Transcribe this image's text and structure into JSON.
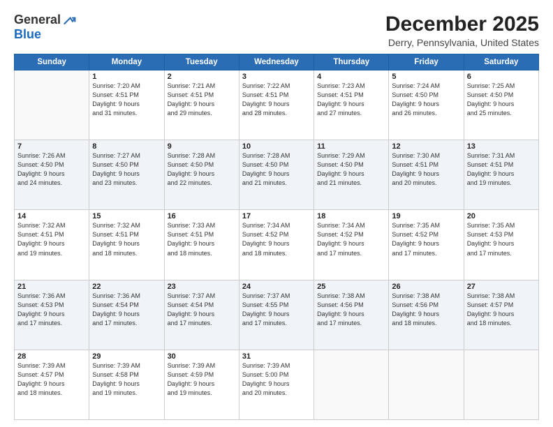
{
  "logo": {
    "general": "General",
    "blue": "Blue"
  },
  "header": {
    "title": "December 2025",
    "subtitle": "Derry, Pennsylvania, United States"
  },
  "days_of_week": [
    "Sunday",
    "Monday",
    "Tuesday",
    "Wednesday",
    "Thursday",
    "Friday",
    "Saturday"
  ],
  "weeks": [
    [
      {
        "day": "",
        "info": ""
      },
      {
        "day": "1",
        "info": "Sunrise: 7:20 AM\nSunset: 4:51 PM\nDaylight: 9 hours\nand 31 minutes."
      },
      {
        "day": "2",
        "info": "Sunrise: 7:21 AM\nSunset: 4:51 PM\nDaylight: 9 hours\nand 29 minutes."
      },
      {
        "day": "3",
        "info": "Sunrise: 7:22 AM\nSunset: 4:51 PM\nDaylight: 9 hours\nand 28 minutes."
      },
      {
        "day": "4",
        "info": "Sunrise: 7:23 AM\nSunset: 4:51 PM\nDaylight: 9 hours\nand 27 minutes."
      },
      {
        "day": "5",
        "info": "Sunrise: 7:24 AM\nSunset: 4:50 PM\nDaylight: 9 hours\nand 26 minutes."
      },
      {
        "day": "6",
        "info": "Sunrise: 7:25 AM\nSunset: 4:50 PM\nDaylight: 9 hours\nand 25 minutes."
      }
    ],
    [
      {
        "day": "7",
        "info": "Sunrise: 7:26 AM\nSunset: 4:50 PM\nDaylight: 9 hours\nand 24 minutes."
      },
      {
        "day": "8",
        "info": "Sunrise: 7:27 AM\nSunset: 4:50 PM\nDaylight: 9 hours\nand 23 minutes."
      },
      {
        "day": "9",
        "info": "Sunrise: 7:28 AM\nSunset: 4:50 PM\nDaylight: 9 hours\nand 22 minutes."
      },
      {
        "day": "10",
        "info": "Sunrise: 7:28 AM\nSunset: 4:50 PM\nDaylight: 9 hours\nand 21 minutes."
      },
      {
        "day": "11",
        "info": "Sunrise: 7:29 AM\nSunset: 4:50 PM\nDaylight: 9 hours\nand 21 minutes."
      },
      {
        "day": "12",
        "info": "Sunrise: 7:30 AM\nSunset: 4:51 PM\nDaylight: 9 hours\nand 20 minutes."
      },
      {
        "day": "13",
        "info": "Sunrise: 7:31 AM\nSunset: 4:51 PM\nDaylight: 9 hours\nand 19 minutes."
      }
    ],
    [
      {
        "day": "14",
        "info": "Sunrise: 7:32 AM\nSunset: 4:51 PM\nDaylight: 9 hours\nand 19 minutes."
      },
      {
        "day": "15",
        "info": "Sunrise: 7:32 AM\nSunset: 4:51 PM\nDaylight: 9 hours\nand 18 minutes."
      },
      {
        "day": "16",
        "info": "Sunrise: 7:33 AM\nSunset: 4:51 PM\nDaylight: 9 hours\nand 18 minutes."
      },
      {
        "day": "17",
        "info": "Sunrise: 7:34 AM\nSunset: 4:52 PM\nDaylight: 9 hours\nand 18 minutes."
      },
      {
        "day": "18",
        "info": "Sunrise: 7:34 AM\nSunset: 4:52 PM\nDaylight: 9 hours\nand 17 minutes."
      },
      {
        "day": "19",
        "info": "Sunrise: 7:35 AM\nSunset: 4:52 PM\nDaylight: 9 hours\nand 17 minutes."
      },
      {
        "day": "20",
        "info": "Sunrise: 7:35 AM\nSunset: 4:53 PM\nDaylight: 9 hours\nand 17 minutes."
      }
    ],
    [
      {
        "day": "21",
        "info": "Sunrise: 7:36 AM\nSunset: 4:53 PM\nDaylight: 9 hours\nand 17 minutes."
      },
      {
        "day": "22",
        "info": "Sunrise: 7:36 AM\nSunset: 4:54 PM\nDaylight: 9 hours\nand 17 minutes."
      },
      {
        "day": "23",
        "info": "Sunrise: 7:37 AM\nSunset: 4:54 PM\nDaylight: 9 hours\nand 17 minutes."
      },
      {
        "day": "24",
        "info": "Sunrise: 7:37 AM\nSunset: 4:55 PM\nDaylight: 9 hours\nand 17 minutes."
      },
      {
        "day": "25",
        "info": "Sunrise: 7:38 AM\nSunset: 4:56 PM\nDaylight: 9 hours\nand 17 minutes."
      },
      {
        "day": "26",
        "info": "Sunrise: 7:38 AM\nSunset: 4:56 PM\nDaylight: 9 hours\nand 18 minutes."
      },
      {
        "day": "27",
        "info": "Sunrise: 7:38 AM\nSunset: 4:57 PM\nDaylight: 9 hours\nand 18 minutes."
      }
    ],
    [
      {
        "day": "28",
        "info": "Sunrise: 7:39 AM\nSunset: 4:57 PM\nDaylight: 9 hours\nand 18 minutes."
      },
      {
        "day": "29",
        "info": "Sunrise: 7:39 AM\nSunset: 4:58 PM\nDaylight: 9 hours\nand 19 minutes."
      },
      {
        "day": "30",
        "info": "Sunrise: 7:39 AM\nSunset: 4:59 PM\nDaylight: 9 hours\nand 19 minutes."
      },
      {
        "day": "31",
        "info": "Sunrise: 7:39 AM\nSunset: 5:00 PM\nDaylight: 9 hours\nand 20 minutes."
      },
      {
        "day": "",
        "info": ""
      },
      {
        "day": "",
        "info": ""
      },
      {
        "day": "",
        "info": ""
      }
    ]
  ]
}
